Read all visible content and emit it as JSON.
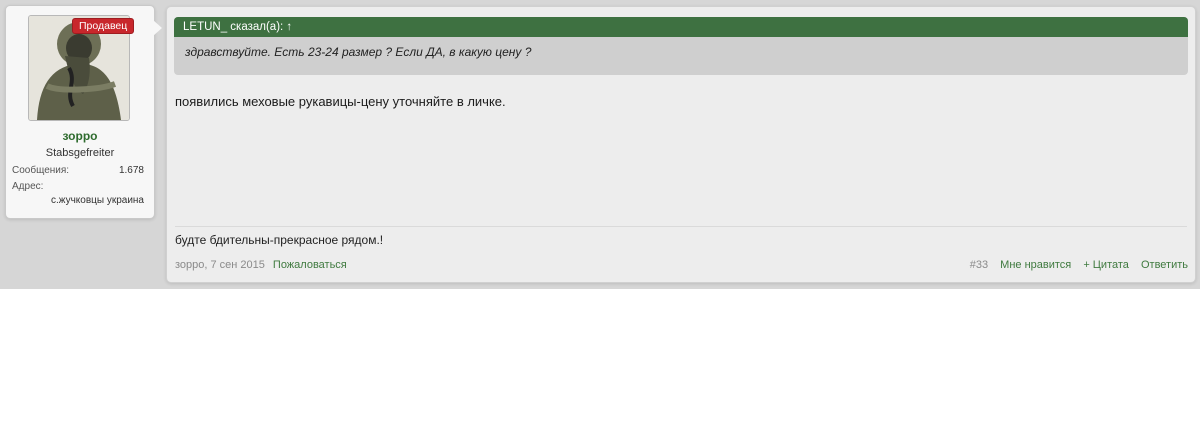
{
  "user": {
    "badge": "Продавец",
    "username": "зорро",
    "title": "Stabsgefreiter",
    "messages_label": "Сообщения:",
    "messages_value": "1.678",
    "address_label": "Адрес:",
    "address_value": "с.жучковцы украина"
  },
  "post": {
    "quote_author": "LETUN_ сказал(а): ↑",
    "quote_text": "здравствуйте. Есть 23-24 размер ? Если ДА, в какую цену ?",
    "message": "появились меховые рукавицы-цену уточняйте в личке.",
    "signature": "будте бдительны-прекрасное рядом.!",
    "meta": {
      "author_date": "зорро, 7 сен 2015",
      "report": "Пожаловаться",
      "number": "#33",
      "like": "Мне нравится",
      "quote": "+ Цитата",
      "reply": "Ответить"
    }
  },
  "colors": {
    "quote_header": "#3e7141",
    "link": "#3f7a3f",
    "badge": "#c8272c"
  }
}
